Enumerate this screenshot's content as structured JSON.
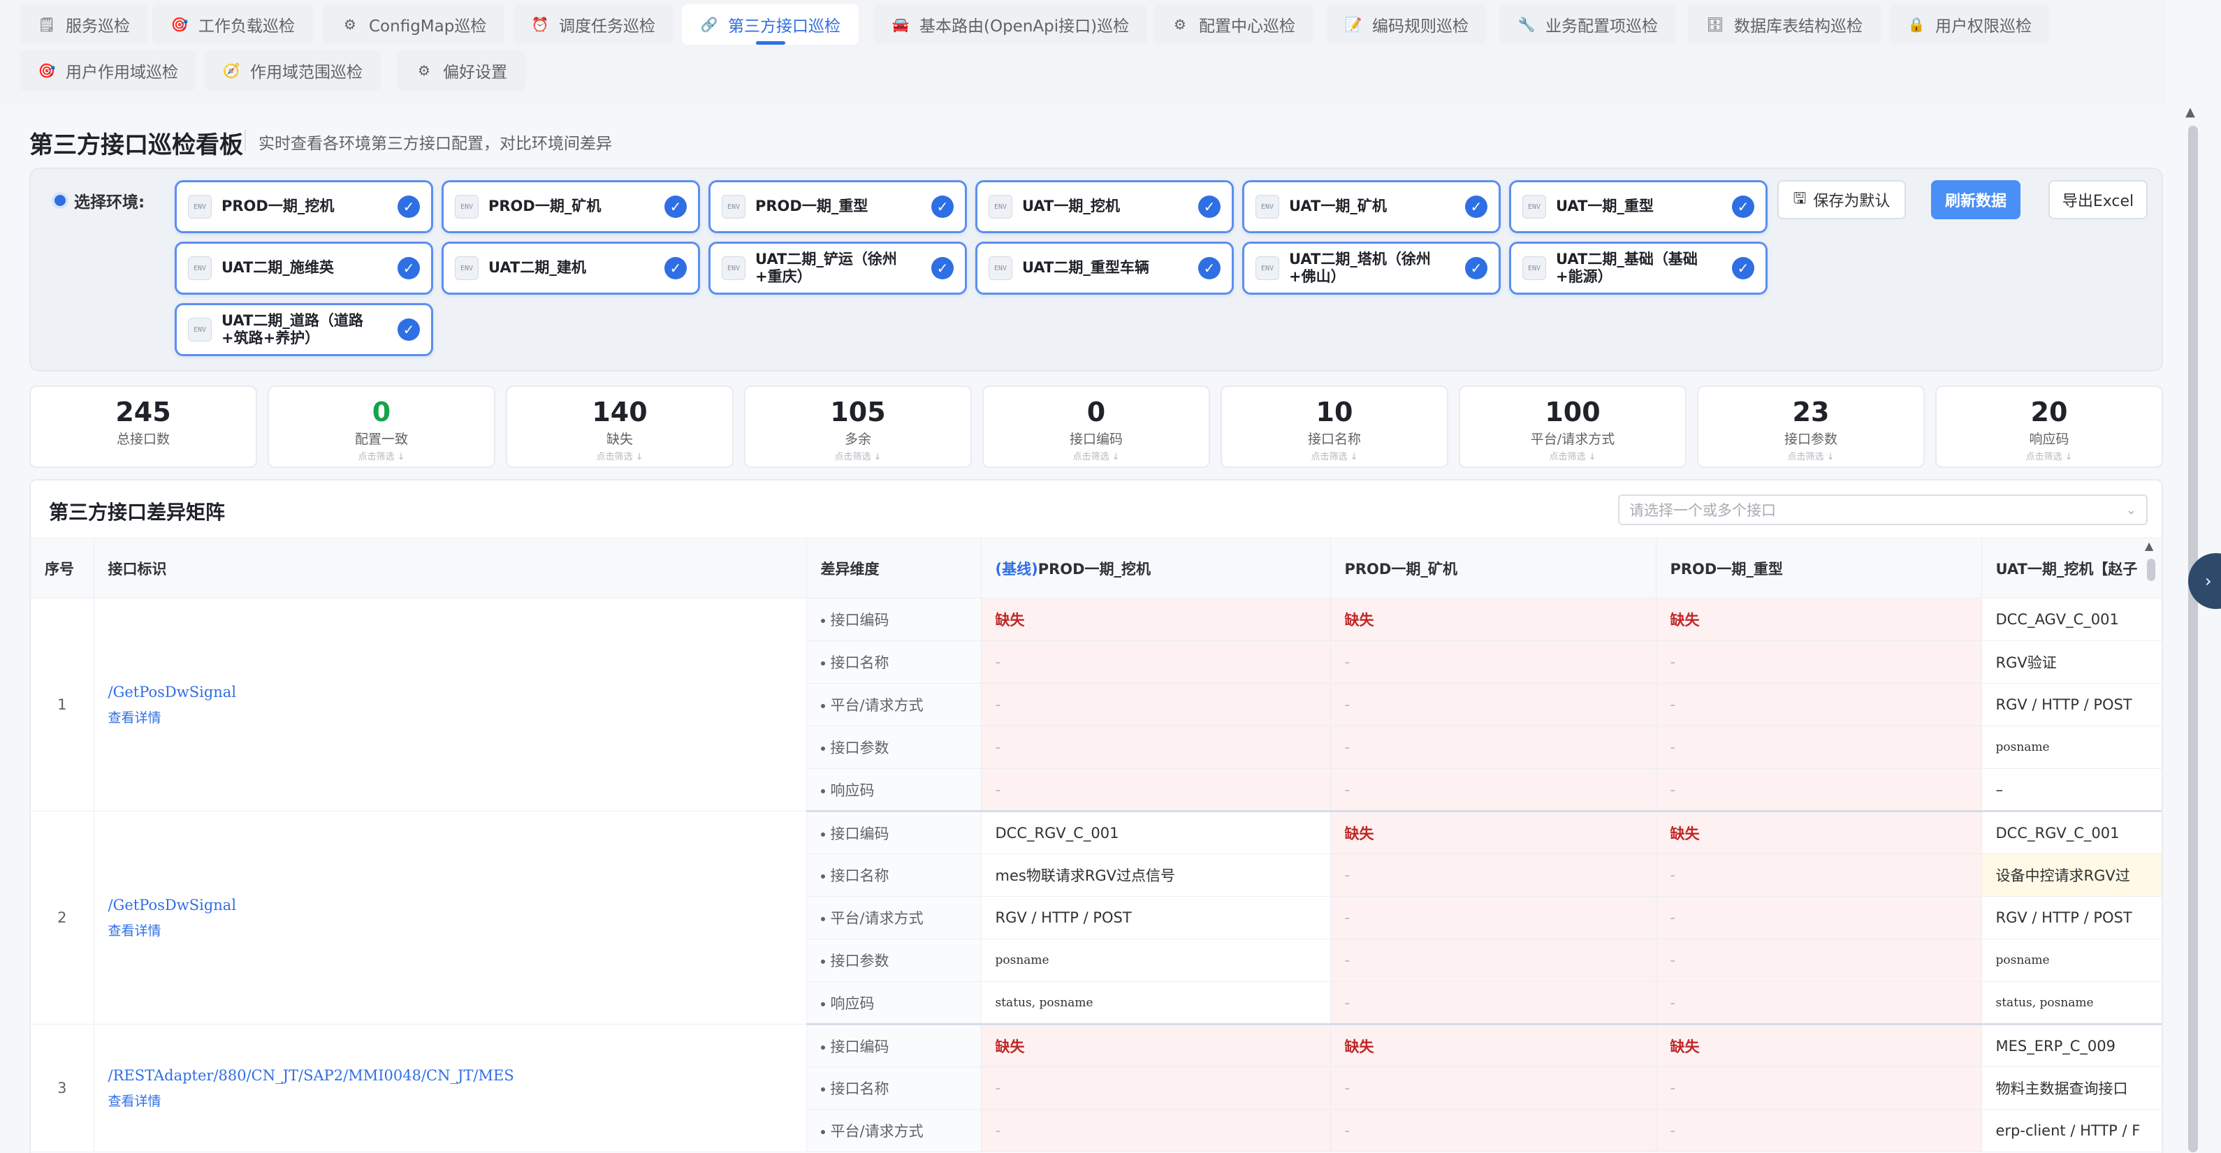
{
  "nav_tabs": [
    {
      "label": "服务巡检",
      "icon": "document-icon",
      "active": false
    },
    {
      "label": "工作负载巡检",
      "icon": "target-icon",
      "active": false
    },
    {
      "label": "ConfigMap巡检",
      "icon": "gear-icon",
      "active": false
    },
    {
      "label": "调度任务巡检",
      "icon": "alarm-clock-icon",
      "active": false
    },
    {
      "label": "第三方接口巡检",
      "icon": "link-icon",
      "active": true
    },
    {
      "label": "基本路由(OpenApi接口)巡检",
      "icon": "car-icon",
      "active": false
    },
    {
      "label": "配置中心巡检",
      "icon": "gear-icon",
      "active": false
    },
    {
      "label": "编码规则巡检",
      "icon": "memo-icon",
      "active": false
    },
    {
      "label": "业务配置项巡检",
      "icon": "wrench-icon",
      "active": false
    },
    {
      "label": "数据库表结构巡检",
      "icon": "database-icon",
      "active": false
    },
    {
      "label": "用户权限巡检",
      "icon": "lock-icon",
      "active": false
    },
    {
      "label": "用户作用域巡检",
      "icon": "target-icon",
      "active": false
    },
    {
      "label": "作用域范围巡检",
      "icon": "compass-icon",
      "active": false
    },
    {
      "label": "偏好设置",
      "icon": "gear-icon",
      "active": false
    }
  ],
  "header": {
    "title": "第三方接口巡检看板",
    "subtitle": "实时查看各环境第三方接口配置，对比环境间差异"
  },
  "env_select": {
    "label": "选择环境:",
    "env_icon_text": "ENV",
    "check_glyph": "✓",
    "chips": [
      "PROD一期_挖机",
      "PROD一期_矿机",
      "PROD一期_重型",
      "UAT一期_挖机",
      "UAT一期_矿机",
      "UAT一期_重型",
      "UAT二期_施维英",
      "UAT二期_建机",
      "UAT二期_铲运（徐州+重庆）",
      "UAT二期_重型车辆",
      "UAT二期_塔机（徐州+佛山）",
      "UAT二期_基础（基础+能源）",
      "UAT二期_道路（道路+筑路+养护）"
    ],
    "save_default_label": "保存为默认",
    "refresh_label": "刷新数据",
    "export_label": "导出Excel"
  },
  "stats": [
    {
      "value": "245",
      "label": "总接口数",
      "hint": "",
      "color": "#1f2329"
    },
    {
      "value": "0",
      "label": "配置一致",
      "hint": "点击筛选 ↓",
      "color": "#16a34a"
    },
    {
      "value": "140",
      "label": "缺失",
      "hint": "点击筛选 ↓",
      "color": "#1f2329"
    },
    {
      "value": "105",
      "label": "多余",
      "hint": "点击筛选 ↓",
      "color": "#1f2329"
    },
    {
      "value": "0",
      "label": "接口编码",
      "hint": "点击筛选 ↓",
      "color": "#1f2329"
    },
    {
      "value": "10",
      "label": "接口名称",
      "hint": "点击筛选 ↓",
      "color": "#1f2329"
    },
    {
      "value": "100",
      "label": "平台/请求方式",
      "hint": "点击筛选 ↓",
      "color": "#1f2329"
    },
    {
      "value": "23",
      "label": "接口参数",
      "hint": "点击筛选 ↓",
      "color": "#1f2329"
    },
    {
      "value": "20",
      "label": "响应码",
      "hint": "点击筛选 ↓",
      "color": "#1f2329"
    }
  ],
  "matrix": {
    "title": "第三方接口差异矩阵",
    "select_placeholder": "请选择一个或多个接口",
    "columns": {
      "seq": "序号",
      "api": "接口标识",
      "dim": "差异维度",
      "baseline_tag": "(基线)",
      "env1": "PROD一期_挖机",
      "env2": "PROD一期_矿机",
      "env3": "PROD一期_重型",
      "env4": "UAT一期_挖机【赵子"
    },
    "dims": [
      "接口编码",
      "接口名称",
      "平台/请求方式",
      "接口参数",
      "响应码"
    ],
    "missing_label": "缺失",
    "dash": "-",
    "detail_link": "查看详情",
    "groups": [
      {
        "seq": "1",
        "path": "/GetPosDwSignal",
        "env4": [
          "DCC_AGV_C_001",
          "RGV验证",
          "RGV / HTTP / POST",
          "posname",
          "–"
        ]
      },
      {
        "seq": "2",
        "path": "/GetPosDwSignal",
        "env1": [
          "DCC_RGV_C_001",
          "mes物联请求RGV过点信号",
          "RGV / HTTP / POST",
          "posname",
          "status, posname"
        ],
        "env4": [
          "DCC_RGV_C_001",
          "设备中控请求RGV过",
          "RGV / HTTP / POST",
          "posname",
          "status, posname"
        ]
      },
      {
        "seq": "3",
        "path": "/RESTAdapter/880/CN_JT/SAP2/MMI0048/CN_JT/MES",
        "env4": [
          "MES_ERP_C_009",
          "物料主数据查询接口",
          "erp-client / HTTP / F"
        ]
      }
    ]
  }
}
